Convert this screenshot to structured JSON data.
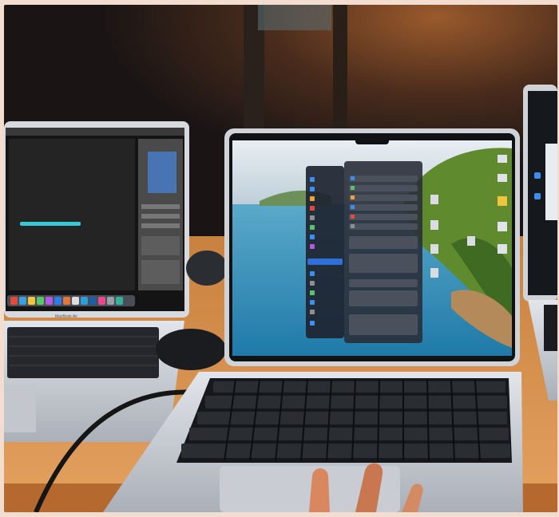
{
  "left_laptop": {
    "brand_label": "MacBook Air"
  },
  "colors": {
    "wall_dark": "#1f1a18",
    "wall_warm": "#7a4a2a",
    "desk_wood": "#d7914f",
    "laptop_silver": "#cfd3d8",
    "keyboard_key": "#1d1f22",
    "photoshop_bg": "#2b2b2b",
    "cyan_line": "#37c9d6",
    "sea": "#2f8fb8",
    "hill_green": "#5f8a2e"
  },
  "icons": [
    "dock-icons",
    "folder-icons",
    "trackpad",
    "mouse",
    "finger"
  ]
}
